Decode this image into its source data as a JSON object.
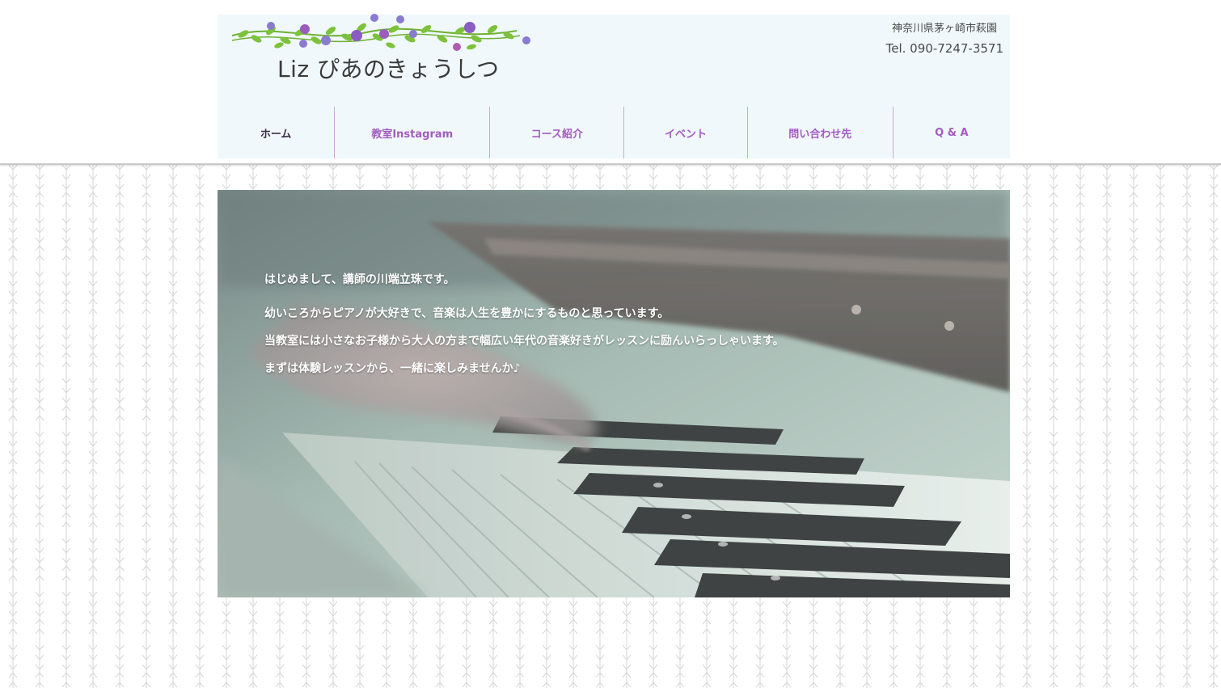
{
  "header": {
    "site_title": "Liz ぴあのきょうしつ",
    "address": "神奈川県茅ヶ崎市萩園",
    "phone": "Tel. 090-7247-3571"
  },
  "nav": {
    "items": [
      {
        "label": "ホーム",
        "active": true
      },
      {
        "label": "教室Instagram",
        "active": false
      },
      {
        "label": "コース紹介",
        "active": false
      },
      {
        "label": "イベント",
        "active": false
      },
      {
        "label": "問い合わせ先",
        "active": false
      },
      {
        "label": "Q & A",
        "active": false
      }
    ]
  },
  "hero": {
    "greeting": "はじめまして、講師の川端立珠です。",
    "lines": [
      "幼いころからピアノが大好きで、音楽は人生を豊かにするものと思っています。",
      "当教室には小さなお子様から大人の方まで幅広い年代の音楽好きがレッスンに励んいらっしゃいます。",
      "まずは体験レッスンから、一緒に楽しみませんか♪"
    ]
  },
  "colors": {
    "nav_text": "#a35bc0",
    "nav_active": "#3d2b45",
    "header_bg": "#f0f8fc",
    "vine_leaf": "#7cc23a",
    "berry_purple": "#8a5cc4"
  }
}
